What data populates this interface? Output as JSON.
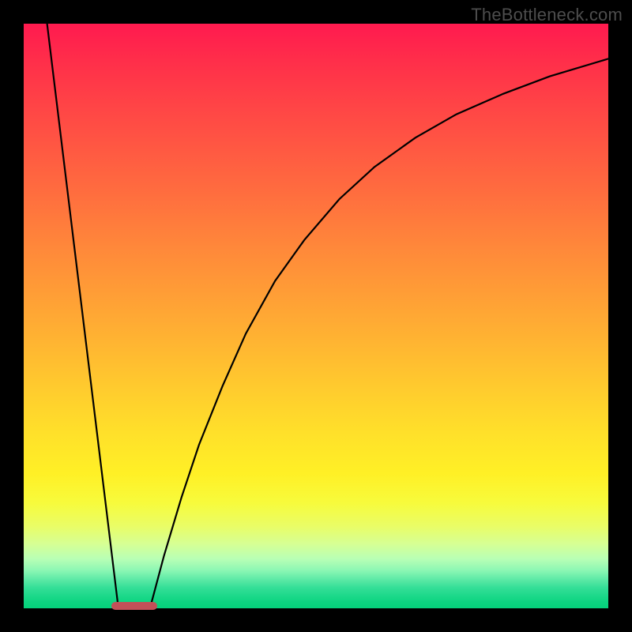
{
  "watermark": "TheBottleneck.com",
  "chart_data": {
    "type": "line",
    "title": "",
    "xlabel": "",
    "ylabel": "",
    "xlim": [
      0,
      100
    ],
    "ylim": [
      0,
      100
    ],
    "grid": false,
    "legend": false,
    "series": [
      {
        "name": "left-branch",
        "x": [
          4.0,
          16.2
        ],
        "y": [
          100,
          0
        ]
      },
      {
        "name": "right-branch",
        "x": [
          21.6,
          24,
          27,
          30,
          34,
          38,
          43,
          48,
          54,
          60,
          67,
          74,
          82,
          90,
          100
        ],
        "y": [
          0,
          9,
          19,
          28,
          38,
          47,
          56,
          63,
          70,
          75.5,
          80.5,
          84.5,
          88,
          91,
          94
        ]
      }
    ],
    "marker": {
      "x_start": 15.0,
      "x_end": 22.8,
      "y": 0,
      "color": "#c25058"
    },
    "background_gradient": {
      "top": "#ff1a4f",
      "bottom": "#05d27b"
    }
  }
}
